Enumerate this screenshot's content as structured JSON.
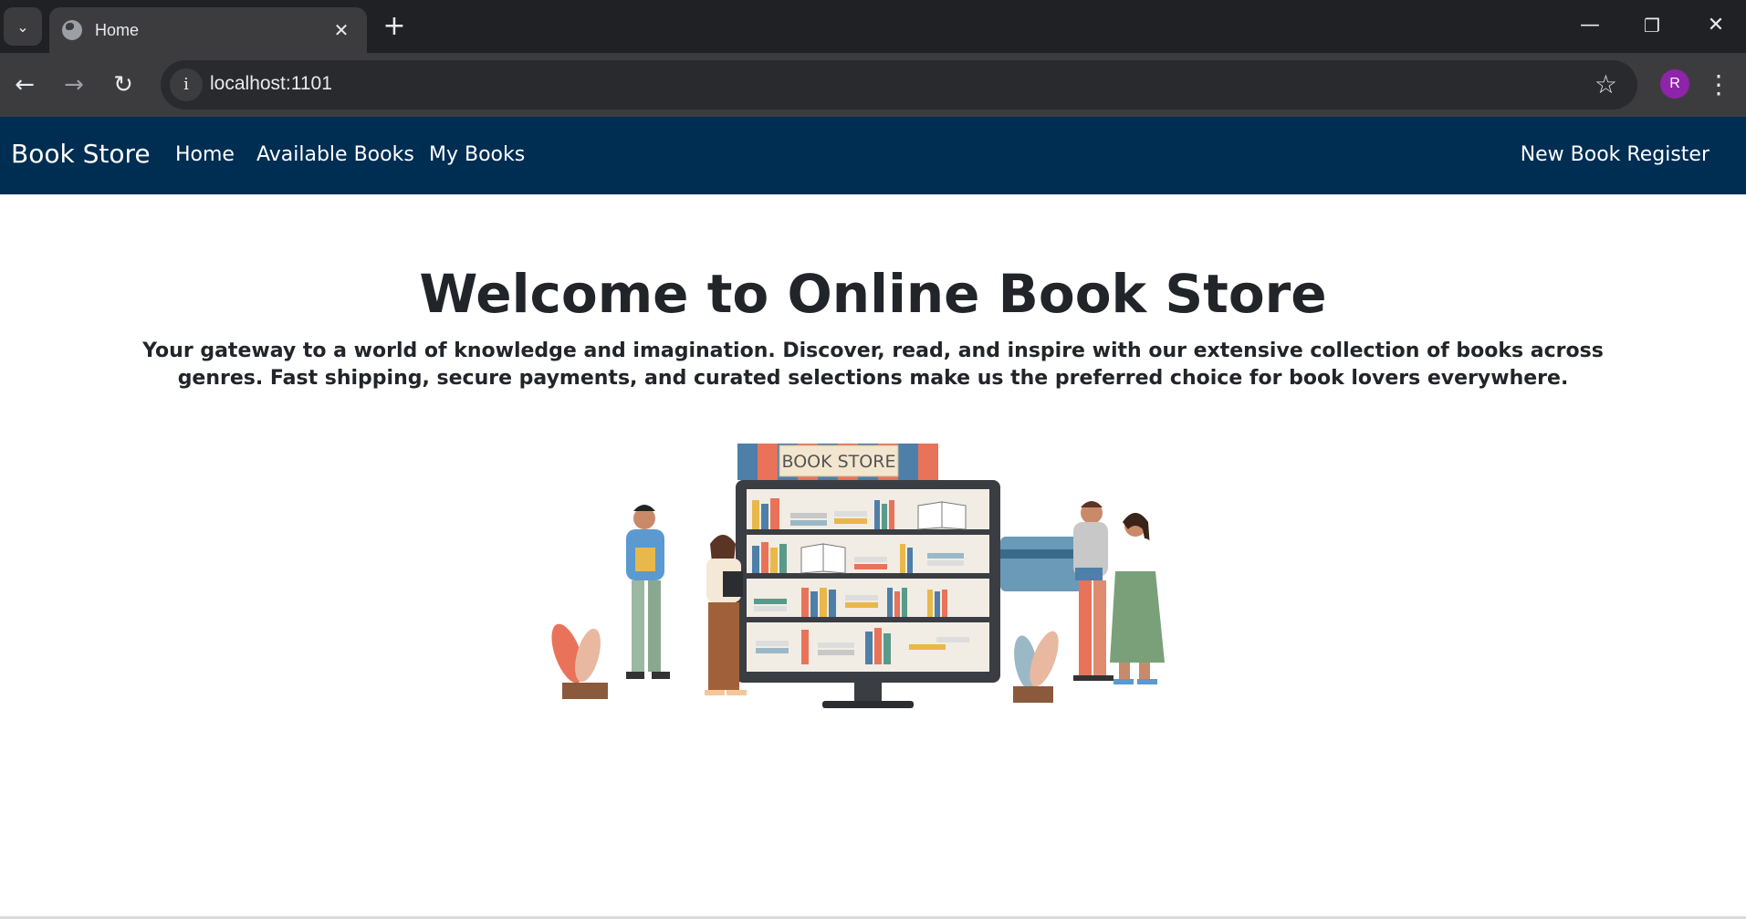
{
  "browser": {
    "tab_title": "Home",
    "url": "localhost:1101",
    "profile_initial": "R"
  },
  "navbar": {
    "brand": "Book Store",
    "links": [
      "Home",
      "Available Books",
      "My Books"
    ],
    "right_link": "New Book Register",
    "background_color": "#002d52"
  },
  "hero": {
    "title": "Welcome to Online Book Store",
    "description": "Your gateway to a world of knowledge and imagination. Discover, read, and inspire with our extensive collection of books across genres. Fast shipping, secure payments, and curated selections make us the preferred choice for book lovers everywhere."
  },
  "illustration": {
    "sign_text": "BOOK STORE"
  }
}
